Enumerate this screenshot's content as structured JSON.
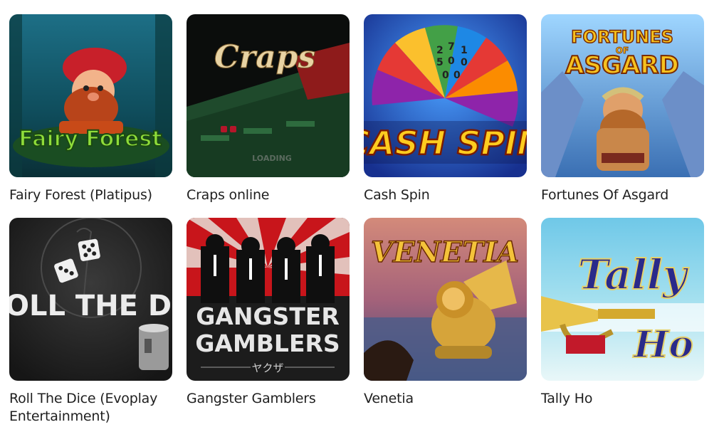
{
  "games": [
    {
      "title": "Fairy Forest (Platipus)",
      "art_text": "Fairy Forest",
      "icon": "gnome-art"
    },
    {
      "title": "Craps online",
      "art_text": "Craps",
      "art_sub": "LOADING",
      "icon": "craps-table-art"
    },
    {
      "title": "Cash Spin",
      "art_text": "CASH SPIN",
      "icon": "prize-wheel-art",
      "wheel_numbers": [
        "2",
        "7",
        "1",
        "5",
        "0",
        "0",
        "0",
        "0"
      ]
    },
    {
      "title": "Fortunes Of Asgard",
      "art_text": "FORTUNES",
      "art_text2": "OF",
      "art_text3": "ASGARD",
      "icon": "viking-art"
    },
    {
      "title": "Roll The Dice (Evoplay Entertainment)",
      "art_text": "OLL THE DIC",
      "icon": "dice-art"
    },
    {
      "title": "Gangster Gamblers",
      "art_text": "GANGSTER",
      "art_text2": "GAMBLERS",
      "art_sub": "ヤクザ",
      "icon": "gangsters-art"
    },
    {
      "title": "Venetia",
      "art_text": "VENETIA",
      "icon": "winged-lion-art"
    },
    {
      "title": "Tally Ho",
      "art_text": "Tally",
      "art_text2": "Ho",
      "icon": "trumpet-art"
    }
  ],
  "colors": {
    "label_text": "#1f1f1f",
    "page_bg": "#ffffff"
  }
}
